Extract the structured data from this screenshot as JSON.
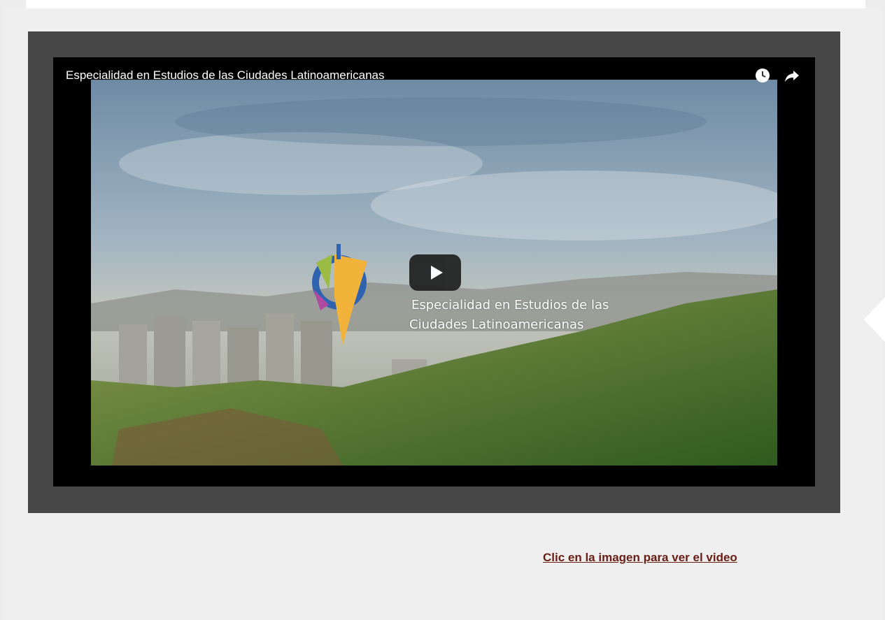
{
  "video": {
    "title": "Especialidad en Estudios de las Ciudades Latinoamericanas",
    "overlay_line1": "Especialidad en Estudios de las",
    "overlay_line2": "Ciudades Latinoamericanas",
    "icons": {
      "watch_later": "clock-icon",
      "share": "share-arrow-icon",
      "play": "play-icon"
    }
  },
  "cta": {
    "label": "Clic en la imagen para ver el video"
  },
  "colors": {
    "frame": "#474747",
    "link": "#6b1d14",
    "play_button": "#1f1f1f"
  }
}
